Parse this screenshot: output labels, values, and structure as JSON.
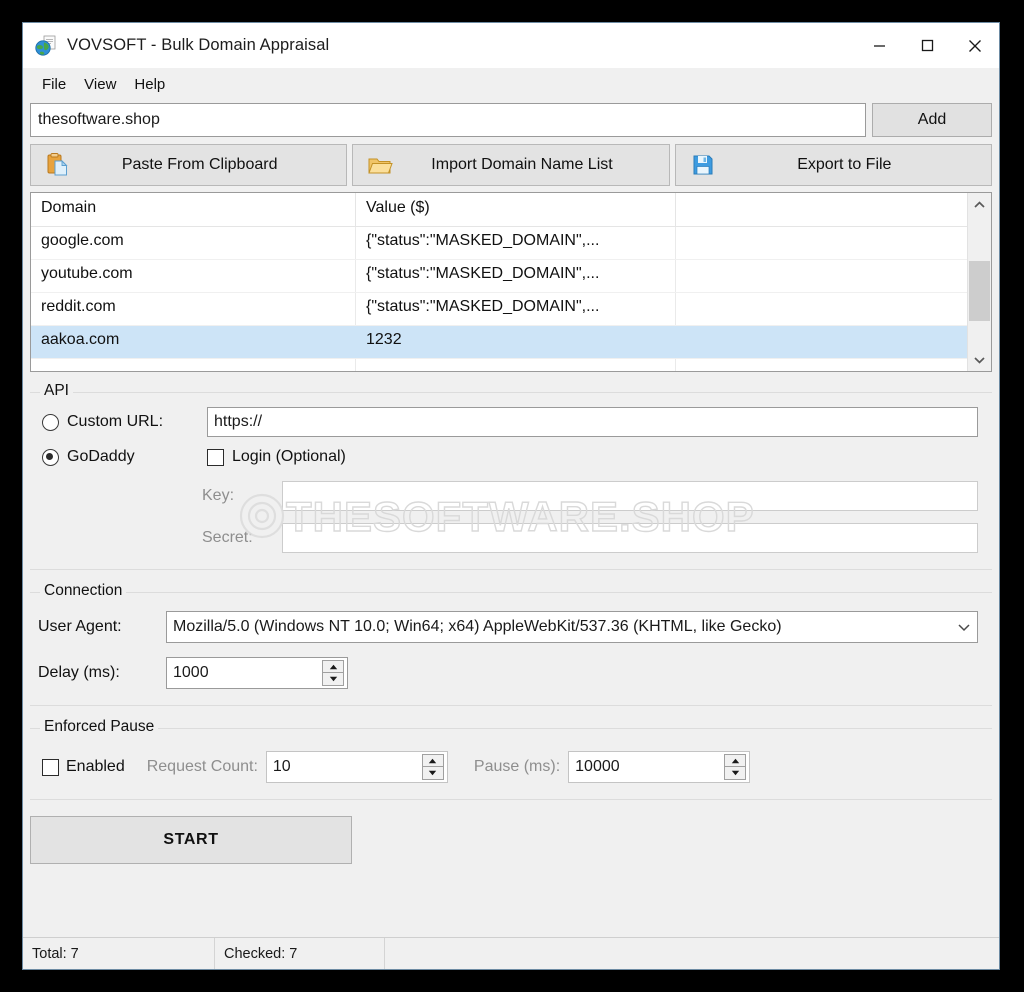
{
  "window": {
    "title": "VOVSOFT - Bulk Domain Appraisal",
    "icon": "globe-document-icon",
    "minimize_label": "Minimize",
    "maximize_label": "Maximize",
    "close_label": "Close"
  },
  "menu": {
    "items": [
      {
        "label": "File"
      },
      {
        "label": "View"
      },
      {
        "label": "Help"
      }
    ]
  },
  "domain_entry": {
    "value": "thesoftware.shop",
    "placeholder": "",
    "add_label": "Add"
  },
  "toolbar": {
    "buttons": [
      {
        "label": "Paste From Clipboard",
        "icon": "clipboard-paste-icon"
      },
      {
        "label": "Import Domain Name List",
        "icon": "folder-open-icon"
      },
      {
        "label": "Export to File",
        "icon": "floppy-save-icon"
      }
    ]
  },
  "list": {
    "columns": [
      "Domain",
      "Value ($)",
      ""
    ],
    "rows": [
      {
        "domain": "google.com",
        "value": "{\"status\":\"MASKED_DOMAIN\",...",
        "selected": false
      },
      {
        "domain": "youtube.com",
        "value": "{\"status\":\"MASKED_DOMAIN\",...",
        "selected": false
      },
      {
        "domain": "reddit.com",
        "value": "{\"status\":\"MASKED_DOMAIN\",...",
        "selected": false
      },
      {
        "domain": "aakoa.com",
        "value": "1232",
        "selected": true
      }
    ],
    "scroll_up_icon": "chevron-up-icon",
    "scroll_down_icon": "chevron-down-icon"
  },
  "api": {
    "title": "API",
    "custom_url_label": "Custom URL:",
    "custom_url_selected": false,
    "custom_url_value": "https://",
    "godaddy_label": "GoDaddy",
    "godaddy_selected": true,
    "login_label": "Login (Optional)",
    "login_checked": false,
    "key_label": "Key:",
    "key_value": "",
    "secret_label": "Secret:",
    "secret_value": ""
  },
  "connection": {
    "title": "Connection",
    "user_agent_label": "User Agent:",
    "user_agent_value": "Mozilla/5.0 (Windows NT 10.0; Win64; x64) AppleWebKit/537.36 (KHTML, like Gecko)",
    "dropdown_icon": "chevron-down-icon",
    "delay_label": "Delay (ms):",
    "delay_value": "1000"
  },
  "enforced_pause": {
    "title": "Enforced Pause",
    "enabled_label": "Enabled",
    "enabled_checked": false,
    "request_count_label": "Request Count:",
    "request_count_value": "10",
    "pause_label": "Pause (ms):",
    "pause_value": "10000"
  },
  "actions": {
    "start_label": "START"
  },
  "statusbar": {
    "total": "Total: 7",
    "checked": "Checked: 7",
    "extra": ""
  },
  "watermark": {
    "text": "THESOFTWARE.SHOP"
  },
  "colors": {
    "window_bg": "#f0f0f0",
    "selection": "#cde4f7",
    "accent": "#3c7fb1",
    "border": "#9a9a9a"
  }
}
